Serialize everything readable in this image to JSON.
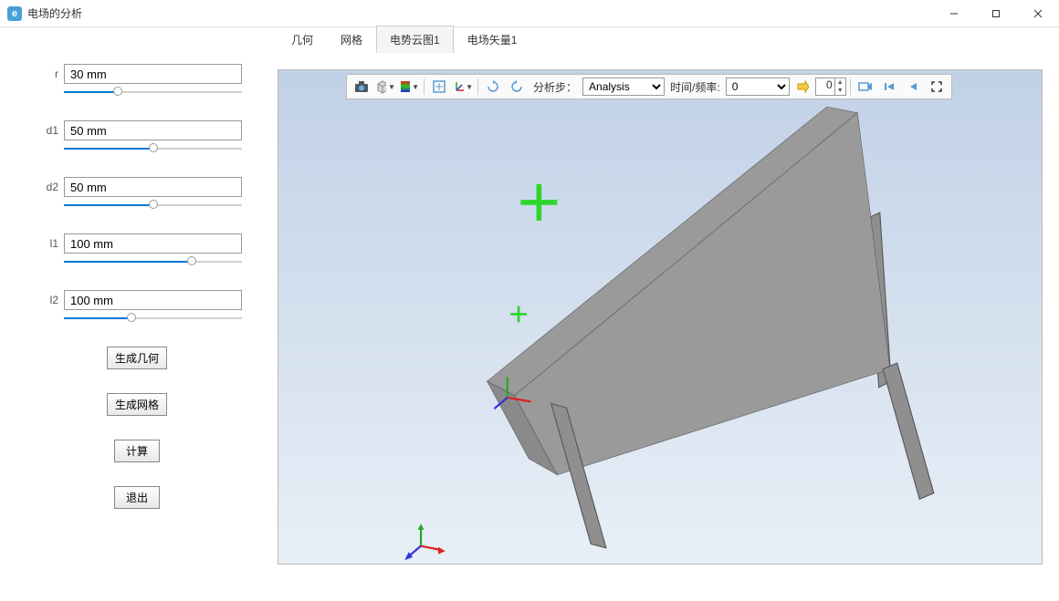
{
  "window": {
    "title": "电场的分析"
  },
  "params": [
    {
      "label": "r",
      "value": "30 mm",
      "fill_pct": 30
    },
    {
      "label": "d1",
      "value": "50 mm",
      "fill_pct": 50
    },
    {
      "label": "d2",
      "value": "50 mm",
      "fill_pct": 50
    },
    {
      "label": "l1",
      "value": "100 mm",
      "fill_pct": 72
    },
    {
      "label": "l2",
      "value": "100 mm",
      "fill_pct": 38
    }
  ],
  "buttons": {
    "gen_geom": "生成几何",
    "gen_mesh": "生成网格",
    "compute": "计算",
    "exit": "退出"
  },
  "tabs": [
    {
      "label": "几何",
      "active": false
    },
    {
      "label": "网格",
      "active": false
    },
    {
      "label": "电势云图1",
      "active": true
    },
    {
      "label": "电场矢量1",
      "active": false
    }
  ],
  "toolbar": {
    "step_label": "分析步：",
    "step_select": "Analysis",
    "time_label": "时间/频率:",
    "time_select": "0",
    "frame_value": "0"
  },
  "icons": {
    "camera": "camera-icon",
    "box": "box-icon",
    "gradient": "gradient-icon",
    "fit": "fit-view-icon",
    "axes": "axes-icon",
    "rotcw": "rotate-cw-icon",
    "rotccw": "rotate-ccw-icon",
    "apply": "apply-icon",
    "video": "video-icon",
    "first": "first-frame-icon",
    "prev": "prev-frame-icon",
    "expand": "expand-icon"
  }
}
